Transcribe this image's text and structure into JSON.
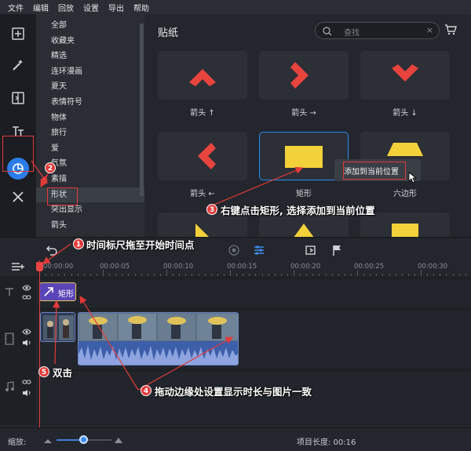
{
  "menu": [
    "文件",
    "编辑",
    "回放",
    "设置",
    "导出",
    "帮助"
  ],
  "categories": [
    "全部",
    "收藏夹",
    "精选",
    "连环漫画",
    "夏天",
    "表情符号",
    "物体",
    "旅行",
    "爱",
    "气氛",
    "素描",
    "形状",
    "突出显示",
    "箭头"
  ],
  "selected_category": "形状",
  "panel": {
    "title": "贴纸",
    "search_placeholder": "查找",
    "search_clear": "×"
  },
  "tiles": [
    {
      "label": "箭头 ↑",
      "shape": "chevron-up"
    },
    {
      "label": "箭头 →",
      "shape": "chevron-right"
    },
    {
      "label": "箭头 ↓",
      "shape": "chevron-down"
    },
    {
      "label": "箭头 ←",
      "shape": "chevron-left"
    },
    {
      "label": "矩形",
      "shape": "rectangle"
    },
    {
      "label": "六边形",
      "shape": "hexagon"
    }
  ],
  "context_menu": {
    "item": "添加到当前位置"
  },
  "ruler": [
    "00:00:00",
    "00:00:05",
    "00:00:10",
    "00:00:15",
    "00:00:20",
    "00:00:25",
    "00:00:30"
  ],
  "clip_title_label": "矩形",
  "bottom": {
    "zoom_label": "缩放:",
    "project_length": "项目长度:  00:16",
    "zoom_level": 0.45
  },
  "annotations": {
    "a1": {
      "num": "1",
      "text": "时间标尺拖至开始时间点"
    },
    "a2": {
      "num": "2"
    },
    "a3": {
      "num": "3",
      "text": "右键点击矩形, 选择添加到当前位置"
    },
    "a4": {
      "num": "4",
      "text": "拖动边缘处设置显示时长与图片一致"
    },
    "a5": {
      "num": "5",
      "text": "双击"
    }
  },
  "colors": {
    "accent": "#2b7de9",
    "annotation_red": "#e23a3a",
    "sticker_red": "#e8443e",
    "sticker_yellow": "#f2d13a",
    "title_clip": "#5a45b8"
  }
}
